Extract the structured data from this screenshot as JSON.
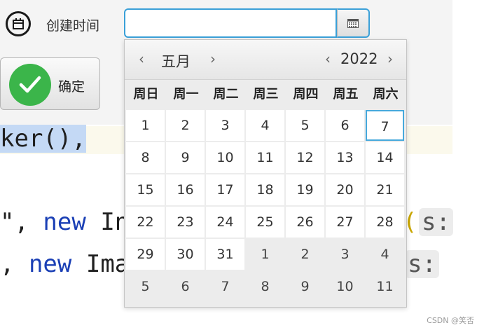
{
  "form": {
    "field_label": "创建时间",
    "date_value": "",
    "date_placeholder": "",
    "confirm_label": "确定"
  },
  "calendar": {
    "month_label": "五月",
    "year_label": "2022",
    "prev_month": "‹",
    "next_month": "›",
    "prev_year": "‹",
    "next_year": "›",
    "weekdays": [
      "周日",
      "周一",
      "周二",
      "周三",
      "周四",
      "周五",
      "周六"
    ],
    "weeks": [
      [
        "1",
        "2",
        "3",
        "4",
        "5",
        "6",
        "7"
      ],
      [
        "8",
        "9",
        "10",
        "11",
        "12",
        "13",
        "14"
      ],
      [
        "15",
        "16",
        "17",
        "18",
        "19",
        "20",
        "21"
      ],
      [
        "22",
        "23",
        "24",
        "25",
        "26",
        "27",
        "28"
      ],
      [
        "29",
        "30",
        "31",
        "1",
        "2",
        "3",
        "4"
      ],
      [
        "5",
        "6",
        "7",
        "8",
        "9",
        "10",
        "11"
      ]
    ],
    "current_month_flags": [
      [
        true,
        true,
        true,
        true,
        true,
        true,
        true
      ],
      [
        true,
        true,
        true,
        true,
        true,
        true,
        true
      ],
      [
        true,
        true,
        true,
        true,
        true,
        true,
        true
      ],
      [
        true,
        true,
        true,
        true,
        true,
        true,
        true
      ],
      [
        true,
        true,
        true,
        false,
        false,
        false,
        false
      ],
      [
        false,
        false,
        false,
        false,
        false,
        false,
        false
      ]
    ],
    "highlighted": {
      "week": 0,
      "day": 6
    }
  },
  "code": {
    "line1_selected": "ker(),",
    "line2_start": "\", ",
    "line2_kw": "new",
    "line2_rest": " In",
    "line2_paren": "(",
    "line2_hint": "s:",
    "line3_start": ", ",
    "line3_kw": "new",
    "line3_rest": " Ima",
    "line3_hint": "s:"
  },
  "watermark": "CSDN @笑否",
  "colors": {
    "accent_border": "#3aa0d8",
    "today_border": "#46a9dc",
    "confirm_green": "#3bb54a",
    "code_selection": "#c4d9f5",
    "keyword_blue": "#1a3fb5"
  },
  "icons": {
    "field_icon": "calendar-icon",
    "picker_icon": "calendar-grid-icon",
    "confirm_icon": "checkmark-icon"
  }
}
